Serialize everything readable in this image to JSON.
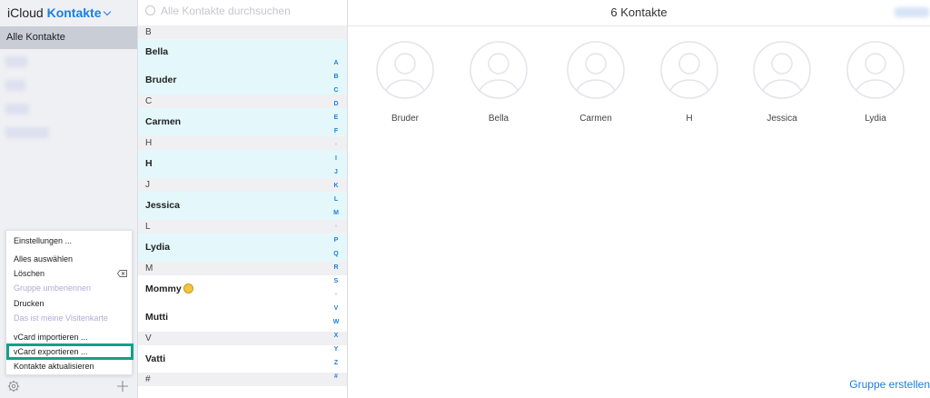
{
  "sidebar": {
    "brand_prefix": "iCloud",
    "brand_app": "Kontakte",
    "all_contacts": "Alle Kontakte",
    "menu": {
      "settings": "Einstellungen ...",
      "select_all": "Alles auswählen",
      "delete": "Löschen",
      "rename_group": "Gruppe umbenennen",
      "print": "Drucken",
      "my_card": "Das ist meine Visitenkarte",
      "import_vcard": "vCard importieren ...",
      "export_vcard": "vCard exportieren ...",
      "refresh": "Kontakte aktualisieren"
    }
  },
  "list": {
    "search_placeholder": "Alle Kontakte durchsuchen",
    "sections": [
      "B",
      "C",
      "H",
      "J",
      "L",
      "M",
      "V",
      "#"
    ],
    "contacts": [
      "Bella",
      "Bruder",
      "Carmen",
      "H",
      "Jessica",
      "Lydia",
      "Mommy",
      "Mutti",
      "Vatti"
    ],
    "index": [
      "A",
      "B",
      "C",
      "D",
      "E",
      "F",
      "•",
      "I",
      "J",
      "K",
      "L",
      "M",
      "•",
      "P",
      "Q",
      "R",
      "S",
      "•",
      "V",
      "W",
      "X",
      "Y",
      "Z",
      "#"
    ]
  },
  "main": {
    "title": "6 Kontakte",
    "cards": [
      "Bruder",
      "Bella",
      "Carmen",
      "H",
      "Jessica",
      "Lydia"
    ],
    "create_group": "Gruppe erstellen"
  },
  "colors": {
    "accent": "#1a7fe0",
    "highlight": "#14a089",
    "row_selected": "#e4f8fb"
  }
}
